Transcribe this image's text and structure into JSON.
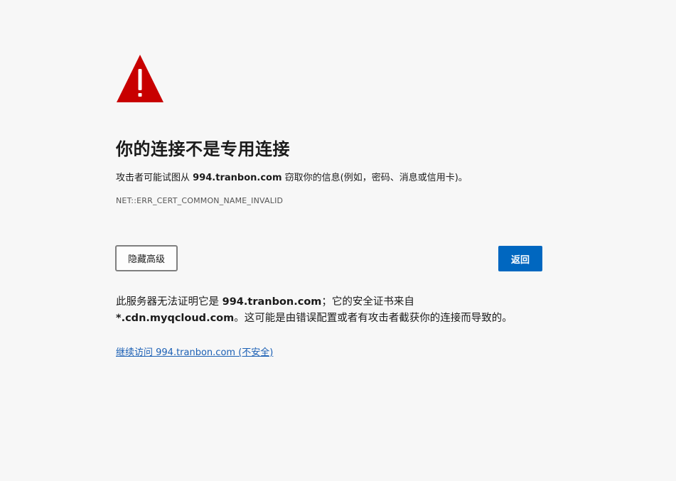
{
  "interstitial": {
    "title": "你的连接不是专用连接",
    "message_prefix": "攻击者可能试图从",
    "message_domain": "994.tranbon.com",
    "message_suffix": "窃取你的信息(例如，密码、消息或信用卡)。",
    "error_code": "NET::ERR_CERT_COMMON_NAME_INVALID",
    "hide_advanced_label": "隐藏高级",
    "back_label": "返回",
    "details_prefix": "此服务器无法证明它是",
    "details_domain": "994.tranbon.com",
    "details_middle": "；它的安全证书来自",
    "details_cert_domain": "*.cdn.myqcloud.com",
    "details_suffix": "。这可能是由错误配置或者有攻击者截获你的连接而导致的。",
    "proceed_link": "继续访问 994.tranbon.com (不安全)"
  },
  "colors": {
    "background": "#f7f7f7",
    "warning_red": "#c80000",
    "primary_button": "#0067c0",
    "link": "#1a5fb4"
  },
  "icons": {
    "warning": "warning-triangle-icon"
  }
}
